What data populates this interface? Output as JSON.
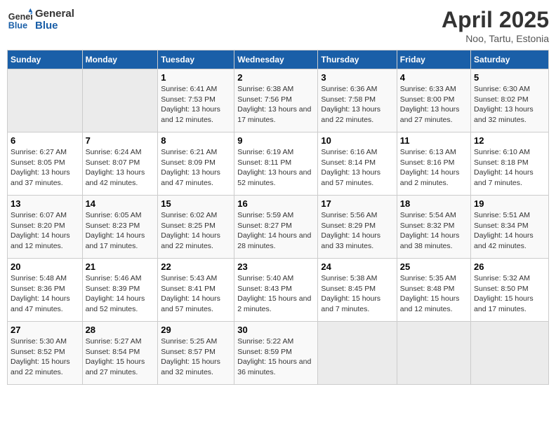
{
  "header": {
    "logo_line1": "General",
    "logo_line2": "Blue",
    "title": "April 2025",
    "subtitle": "Noo, Tartu, Estonia"
  },
  "weekdays": [
    "Sunday",
    "Monday",
    "Tuesday",
    "Wednesday",
    "Thursday",
    "Friday",
    "Saturday"
  ],
  "weeks": [
    [
      {
        "day": "",
        "sunrise": "",
        "sunset": "",
        "daylight": ""
      },
      {
        "day": "",
        "sunrise": "",
        "sunset": "",
        "daylight": ""
      },
      {
        "day": "1",
        "sunrise": "Sunrise: 6:41 AM",
        "sunset": "Sunset: 7:53 PM",
        "daylight": "Daylight: 13 hours and 12 minutes."
      },
      {
        "day": "2",
        "sunrise": "Sunrise: 6:38 AM",
        "sunset": "Sunset: 7:56 PM",
        "daylight": "Daylight: 13 hours and 17 minutes."
      },
      {
        "day": "3",
        "sunrise": "Sunrise: 6:36 AM",
        "sunset": "Sunset: 7:58 PM",
        "daylight": "Daylight: 13 hours and 22 minutes."
      },
      {
        "day": "4",
        "sunrise": "Sunrise: 6:33 AM",
        "sunset": "Sunset: 8:00 PM",
        "daylight": "Daylight: 13 hours and 27 minutes."
      },
      {
        "day": "5",
        "sunrise": "Sunrise: 6:30 AM",
        "sunset": "Sunset: 8:02 PM",
        "daylight": "Daylight: 13 hours and 32 minutes."
      }
    ],
    [
      {
        "day": "6",
        "sunrise": "Sunrise: 6:27 AM",
        "sunset": "Sunset: 8:05 PM",
        "daylight": "Daylight: 13 hours and 37 minutes."
      },
      {
        "day": "7",
        "sunrise": "Sunrise: 6:24 AM",
        "sunset": "Sunset: 8:07 PM",
        "daylight": "Daylight: 13 hours and 42 minutes."
      },
      {
        "day": "8",
        "sunrise": "Sunrise: 6:21 AM",
        "sunset": "Sunset: 8:09 PM",
        "daylight": "Daylight: 13 hours and 47 minutes."
      },
      {
        "day": "9",
        "sunrise": "Sunrise: 6:19 AM",
        "sunset": "Sunset: 8:11 PM",
        "daylight": "Daylight: 13 hours and 52 minutes."
      },
      {
        "day": "10",
        "sunrise": "Sunrise: 6:16 AM",
        "sunset": "Sunset: 8:14 PM",
        "daylight": "Daylight: 13 hours and 57 minutes."
      },
      {
        "day": "11",
        "sunrise": "Sunrise: 6:13 AM",
        "sunset": "Sunset: 8:16 PM",
        "daylight": "Daylight: 14 hours and 2 minutes."
      },
      {
        "day": "12",
        "sunrise": "Sunrise: 6:10 AM",
        "sunset": "Sunset: 8:18 PM",
        "daylight": "Daylight: 14 hours and 7 minutes."
      }
    ],
    [
      {
        "day": "13",
        "sunrise": "Sunrise: 6:07 AM",
        "sunset": "Sunset: 8:20 PM",
        "daylight": "Daylight: 14 hours and 12 minutes."
      },
      {
        "day": "14",
        "sunrise": "Sunrise: 6:05 AM",
        "sunset": "Sunset: 8:23 PM",
        "daylight": "Daylight: 14 hours and 17 minutes."
      },
      {
        "day": "15",
        "sunrise": "Sunrise: 6:02 AM",
        "sunset": "Sunset: 8:25 PM",
        "daylight": "Daylight: 14 hours and 22 minutes."
      },
      {
        "day": "16",
        "sunrise": "Sunrise: 5:59 AM",
        "sunset": "Sunset: 8:27 PM",
        "daylight": "Daylight: 14 hours and 28 minutes."
      },
      {
        "day": "17",
        "sunrise": "Sunrise: 5:56 AM",
        "sunset": "Sunset: 8:29 PM",
        "daylight": "Daylight: 14 hours and 33 minutes."
      },
      {
        "day": "18",
        "sunrise": "Sunrise: 5:54 AM",
        "sunset": "Sunset: 8:32 PM",
        "daylight": "Daylight: 14 hours and 38 minutes."
      },
      {
        "day": "19",
        "sunrise": "Sunrise: 5:51 AM",
        "sunset": "Sunset: 8:34 PM",
        "daylight": "Daylight: 14 hours and 42 minutes."
      }
    ],
    [
      {
        "day": "20",
        "sunrise": "Sunrise: 5:48 AM",
        "sunset": "Sunset: 8:36 PM",
        "daylight": "Daylight: 14 hours and 47 minutes."
      },
      {
        "day": "21",
        "sunrise": "Sunrise: 5:46 AM",
        "sunset": "Sunset: 8:39 PM",
        "daylight": "Daylight: 14 hours and 52 minutes."
      },
      {
        "day": "22",
        "sunrise": "Sunrise: 5:43 AM",
        "sunset": "Sunset: 8:41 PM",
        "daylight": "Daylight: 14 hours and 57 minutes."
      },
      {
        "day": "23",
        "sunrise": "Sunrise: 5:40 AM",
        "sunset": "Sunset: 8:43 PM",
        "daylight": "Daylight: 15 hours and 2 minutes."
      },
      {
        "day": "24",
        "sunrise": "Sunrise: 5:38 AM",
        "sunset": "Sunset: 8:45 PM",
        "daylight": "Daylight: 15 hours and 7 minutes."
      },
      {
        "day": "25",
        "sunrise": "Sunrise: 5:35 AM",
        "sunset": "Sunset: 8:48 PM",
        "daylight": "Daylight: 15 hours and 12 minutes."
      },
      {
        "day": "26",
        "sunrise": "Sunrise: 5:32 AM",
        "sunset": "Sunset: 8:50 PM",
        "daylight": "Daylight: 15 hours and 17 minutes."
      }
    ],
    [
      {
        "day": "27",
        "sunrise": "Sunrise: 5:30 AM",
        "sunset": "Sunset: 8:52 PM",
        "daylight": "Daylight: 15 hours and 22 minutes."
      },
      {
        "day": "28",
        "sunrise": "Sunrise: 5:27 AM",
        "sunset": "Sunset: 8:54 PM",
        "daylight": "Daylight: 15 hours and 27 minutes."
      },
      {
        "day": "29",
        "sunrise": "Sunrise: 5:25 AM",
        "sunset": "Sunset: 8:57 PM",
        "daylight": "Daylight: 15 hours and 32 minutes."
      },
      {
        "day": "30",
        "sunrise": "Sunrise: 5:22 AM",
        "sunset": "Sunset: 8:59 PM",
        "daylight": "Daylight: 15 hours and 36 minutes."
      },
      {
        "day": "",
        "sunrise": "",
        "sunset": "",
        "daylight": ""
      },
      {
        "day": "",
        "sunrise": "",
        "sunset": "",
        "daylight": ""
      },
      {
        "day": "",
        "sunrise": "",
        "sunset": "",
        "daylight": ""
      }
    ]
  ]
}
